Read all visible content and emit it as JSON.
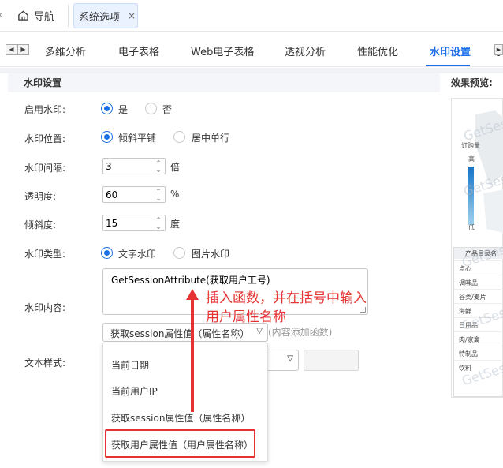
{
  "topbar": {
    "home_label": "导航",
    "active_tab_label": "系统选项",
    "close_glyph": "×"
  },
  "subnav": {
    "tabs": [
      "多维分析",
      "电子表格",
      "Web电子表格",
      "透视分析",
      "性能优化",
      "水印设置",
      "系"
    ],
    "active_index": 5
  },
  "panel": {
    "title": "水印设置",
    "preview_title": "效果预览:"
  },
  "form": {
    "enable": {
      "label": "启用水印:",
      "options": [
        "是",
        "否"
      ],
      "selected": "是"
    },
    "position": {
      "label": "水印位置:",
      "options": [
        "倾斜平铺",
        "居中单行"
      ],
      "selected": "倾斜平铺"
    },
    "spacing": {
      "label": "水印间隔:",
      "value": "3",
      "unit": "倍"
    },
    "opacity": {
      "label": "透明度:",
      "value": "60",
      "unit": "%"
    },
    "tilt": {
      "label": "倾斜度:",
      "value": "15",
      "unit": "度"
    },
    "type": {
      "label": "水印类型:",
      "options": [
        "文字水印",
        "图片水印"
      ],
      "selected": "文字水印"
    },
    "content": {
      "label": "水印内容:",
      "value": "GetSessionAttribute(获取用户工号)"
    },
    "function_select": {
      "value": "获取session属性值（属性名称）",
      "hint": "(内容添加函数)"
    },
    "text_style": {
      "label": "文本样式:"
    }
  },
  "dropdown": {
    "items": [
      "当前日期",
      "当前用户IP",
      "获取session属性值（属性名称）",
      "获取用户属性值（用户属性名称）"
    ],
    "highlighted_index": 3
  },
  "annotation": {
    "line1": "插入函数，并在括号中输入",
    "line2": "用户属性名称",
    "color": "#e53333"
  },
  "preview": {
    "watermark_text": "GetSes",
    "legend_title": "订购量",
    "legend_high": "高",
    "legend_low": "低",
    "table_header": "产品目录名",
    "table_rows": [
      "点心",
      "调味品",
      "谷类/麦片",
      "海鲜",
      "日用品",
      "肉/家禽",
      "特制品",
      "饮料"
    ]
  },
  "colors": {
    "accent": "#1a6ee6",
    "annotation": "#e53333"
  }
}
